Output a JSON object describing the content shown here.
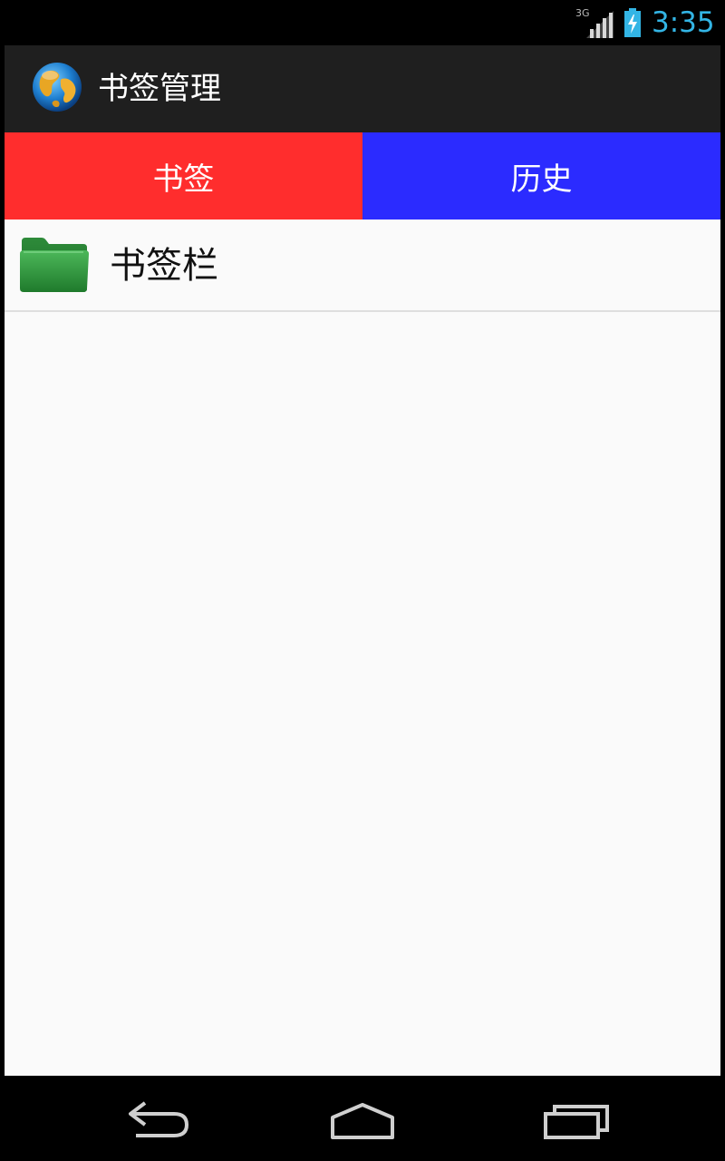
{
  "status_bar": {
    "network": "3G",
    "time": "3:35",
    "time_color": "#33b5e5"
  },
  "action_bar": {
    "title": "书签管理",
    "icon": "globe-icon"
  },
  "tabs": [
    {
      "label": "书签",
      "color": "#ff2d2d"
    },
    {
      "label": "历史",
      "color": "#2b2bff"
    }
  ],
  "list": {
    "items": [
      {
        "label": "书签栏",
        "icon": "folder-icon"
      }
    ]
  },
  "nav_bar": {
    "buttons": [
      "back-icon",
      "home-icon",
      "recent-apps-icon"
    ]
  }
}
